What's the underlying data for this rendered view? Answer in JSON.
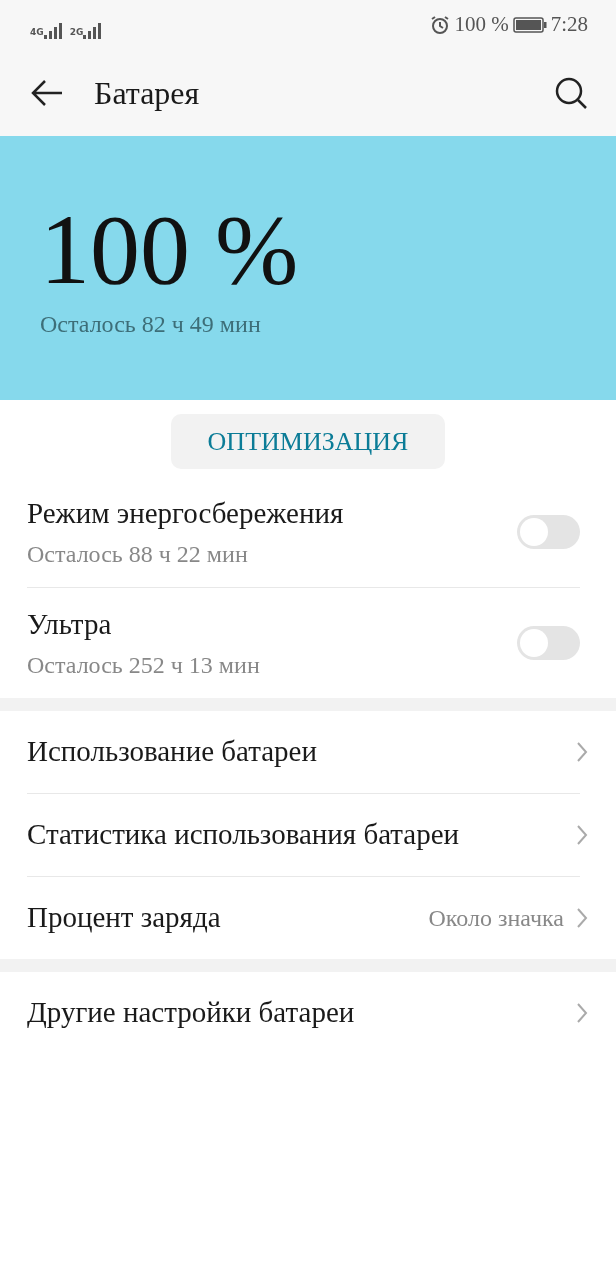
{
  "status_bar": {
    "networks": [
      {
        "label": "4G"
      },
      {
        "label": "2G"
      }
    ],
    "battery_text": "100 %",
    "time": "7:28"
  },
  "header": {
    "title": "Батарея"
  },
  "hero": {
    "percent": "100 %",
    "remaining": "Осталось 82 ч 49 мин"
  },
  "optimize_button": "ОПТИМИЗАЦИЯ",
  "toggles": [
    {
      "title": "Режим энергосбережения",
      "subtitle": "Осталось 88 ч 22 мин",
      "on": false
    },
    {
      "title": "Ультра",
      "subtitle": "Осталось 252 ч 13 мин",
      "on": false
    }
  ],
  "groups": [
    {
      "items": [
        {
          "title": "Использование батареи"
        },
        {
          "title": "Статистика использования батареи"
        },
        {
          "title": "Процент заряда",
          "value": "Около значка"
        }
      ]
    },
    {
      "items": [
        {
          "title": "Другие настройки батареи"
        }
      ]
    }
  ]
}
